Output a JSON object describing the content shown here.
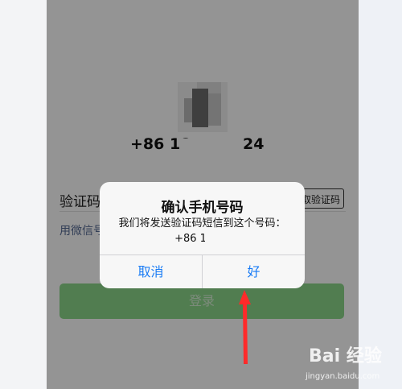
{
  "login_screen": {
    "phone_prefix": "+86 18",
    "phone_suffix": "24",
    "code_label": "验证码",
    "get_code_button": "取验证码",
    "wechat_link": "用微信号",
    "login_button": "登录"
  },
  "dialog": {
    "title": "确认手机号码",
    "message": "我们将发送验证码短信到这个号码：",
    "phone": "+86 18           24",
    "cancel": "取消",
    "ok": "好"
  },
  "watermark": {
    "brand": "Bai 经验",
    "url": "jingyan.baidu.com"
  },
  "colors": {
    "accent_blue": "#1a7cf5",
    "login_green": "#8cd78a",
    "link_color": "#576b95",
    "annotation_red": "#ff2a2a"
  },
  "icons": {
    "avatar": "blurred-avatar-image",
    "arrow": "red-arrow-annotation",
    "paw": "baidu-paw-logo"
  }
}
